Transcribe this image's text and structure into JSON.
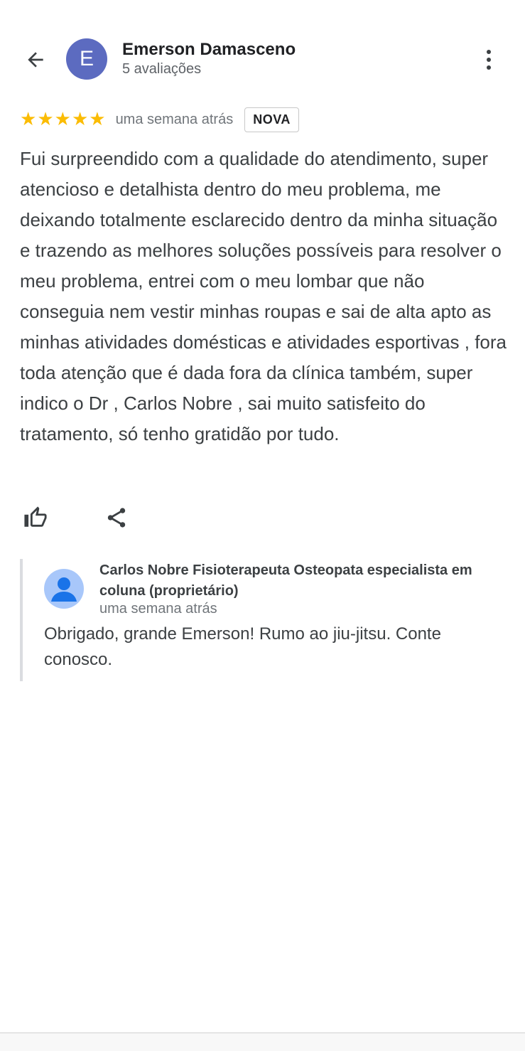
{
  "reviewer": {
    "initial": "E",
    "name": "Emerson Damasceno",
    "reviews_count": "5 avaliações",
    "avatar_color": "#5c6bc0"
  },
  "rating": {
    "stars": 5,
    "star_glyph": "★",
    "star_color": "#fbbc04",
    "time": "uma semana atrás",
    "badge": "NOVA"
  },
  "review": {
    "text": "Fui surpreendido com a qualidade do atendimento, super atencioso e detalhista dentro do meu problema, me deixando totalmente esclarecido dentro da minha situação e trazendo as melhores soluções possíveis para resolver o meu problema, entrei com o meu lombar que não conseguia nem vestir minhas roupas e sai de alta apto as minhas atividades domésticas e atividades esportivas , fora toda atenção que é dada fora da clínica também, super indico o Dr , Carlos Nobre , sai muito satisfeito do tratamento, só tenho gratidão por tudo."
  },
  "icons": {
    "back": "arrow-back-icon",
    "more": "more-vert-icon",
    "like": "thumb-up-icon",
    "share": "share-icon",
    "owner_avatar": "person-icon"
  },
  "owner_response": {
    "name": "Carlos Nobre Fisioterapeuta Osteopata especialista em coluna (proprietário)",
    "time": "uma semana atrás",
    "text": "Obrigado, grande Emerson! Rumo ao jiu-jitsu. Conte conosco.",
    "avatar_color": "#a8c7fa",
    "avatar_figure_color": "#1a73e8"
  }
}
